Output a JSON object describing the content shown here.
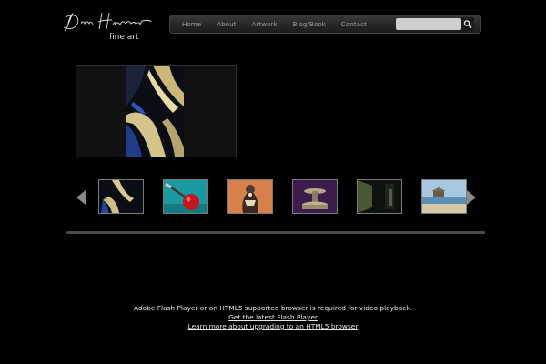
{
  "logo": {
    "signature": "Dan Hermes",
    "subtitle": "fine art"
  },
  "nav": {
    "items": [
      {
        "label": "Home"
      },
      {
        "label": "About"
      },
      {
        "label": "Artwork"
      },
      {
        "label": "Blog/Book"
      },
      {
        "label": "Contact"
      }
    ],
    "search": {
      "value": "",
      "placeholder": "",
      "button_icon": "search-magnifier-icon"
    }
  },
  "gallery": {
    "prev_icon": "triangle-left-icon",
    "next_icon": "triangle-right-icon",
    "thumbnails": [
      {
        "subject": "abstract-dark-swirl",
        "selected": true
      },
      {
        "subject": "apple-with-paintbrush"
      },
      {
        "subject": "ornate-figure-orange"
      },
      {
        "subject": "fountain-purple"
      },
      {
        "subject": "dark-corridor"
      },
      {
        "subject": "beach-pier"
      }
    ]
  },
  "flash_notice": {
    "message": "Adobe Flash Player or an HTML5 supported browser is required for video playback.",
    "link_flash": "Get the latest Flash Player",
    "link_html5": "Learn more about upgrading to an HTML5 browser"
  },
  "colors": {
    "background": "#000000",
    "nav_text": "#9a9a9a",
    "search_field": "#cfcfcf"
  }
}
